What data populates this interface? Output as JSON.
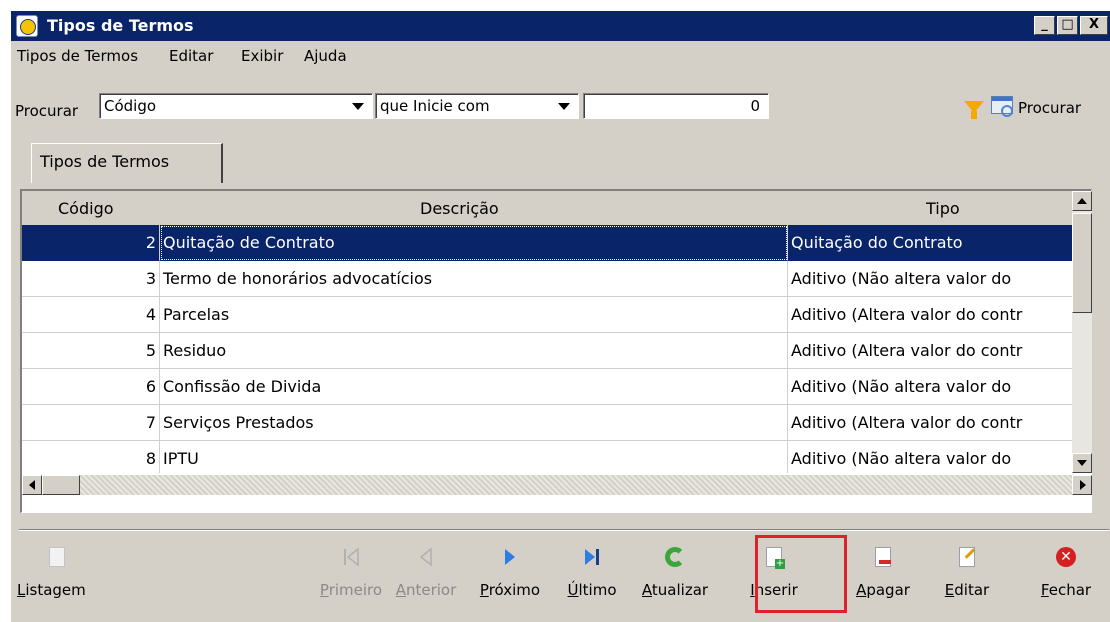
{
  "window": {
    "title": "Tipos de Termos",
    "controls": [
      "_",
      "□",
      "X"
    ]
  },
  "menu": [
    "Tipos de Termos",
    "Editar",
    "Exibir",
    "Ajuda"
  ],
  "search": {
    "label": "Procurar",
    "field_value": "Código",
    "operator_value": "que Inicie com",
    "query_value": "0",
    "button_label": "Procurar",
    "filter_icon": "funnel-icon",
    "search_icon": "search-window-icon"
  },
  "tab": {
    "label": "Tipos de Termos"
  },
  "grid": {
    "columns": [
      "Código",
      "Descrição",
      "Tipo"
    ],
    "rows": [
      {
        "code": "2",
        "desc": "Quitação de Contrato",
        "tipo": "Quitação do Contrato"
      },
      {
        "code": "3",
        "desc": "Termo de honorários advocatícios",
        "tipo": "Aditivo (Não altera valor do"
      },
      {
        "code": "4",
        "desc": "Parcelas",
        "tipo": "Aditivo (Altera valor do contr"
      },
      {
        "code": "5",
        "desc": "Residuo",
        "tipo": "Aditivo (Altera valor do contr"
      },
      {
        "code": "6",
        "desc": "Confissão de Divida",
        "tipo": "Aditivo (Não altera valor do"
      },
      {
        "code": "7",
        "desc": "Serviços Prestados",
        "tipo": "Aditivo (Altera valor do contr"
      },
      {
        "code": "8",
        "desc": "IPTU",
        "tipo": "Aditivo (Não altera valor do"
      }
    ],
    "selected_row": 0,
    "selection_color": "#0a246a"
  },
  "toolbar": {
    "listagem": "Listagem",
    "primeiro": "Primeiro",
    "anterior": "Anterior",
    "proximo": "Próximo",
    "ultimo": "Último",
    "atualizar": "Atualizar",
    "inserir": "Inserir",
    "apagar": "Apagar",
    "editar": "Editar",
    "fechar": "Fechar",
    "highlight_color": "#e0202a"
  }
}
